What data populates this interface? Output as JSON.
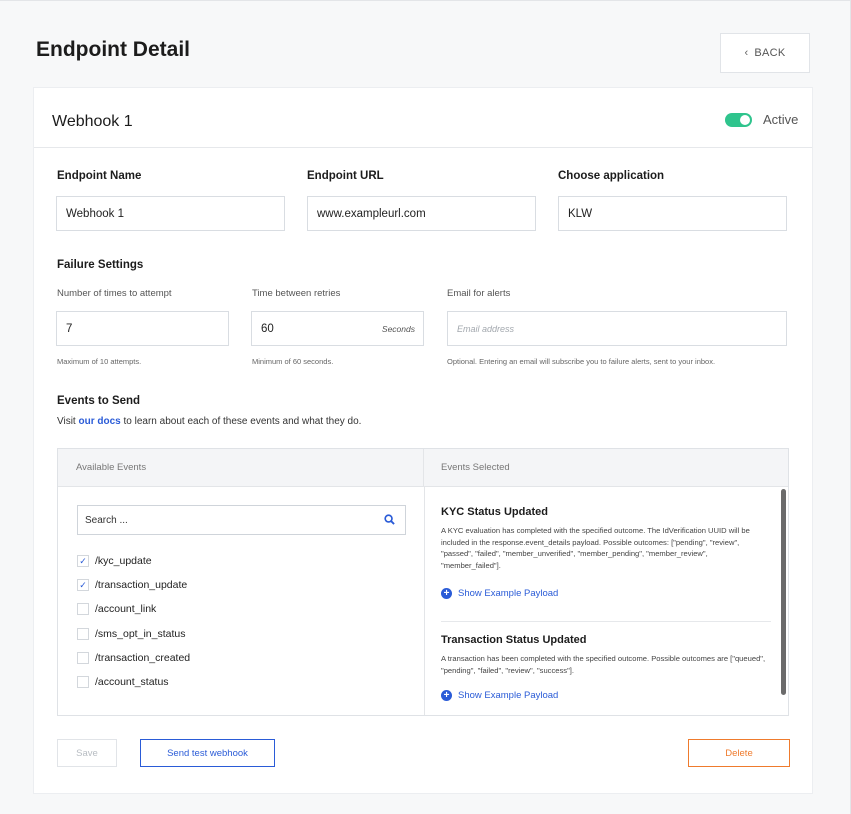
{
  "page": {
    "title": "Endpoint Detail",
    "back_label": "BACK"
  },
  "card": {
    "title": "Webhook 1",
    "status_label": "Active",
    "status_on": true,
    "toggle_color": "#2fc48d"
  },
  "fields": {
    "endpoint_name": {
      "label": "Endpoint Name",
      "value": "Webhook 1"
    },
    "endpoint_url": {
      "label": "Endpoint URL",
      "value": "www.exampleurl.com"
    },
    "application": {
      "label": "Choose application",
      "value": "KLW"
    }
  },
  "failure": {
    "heading": "Failure Settings",
    "attempts": {
      "label": "Number of times to attempt",
      "value": "7",
      "hint": "Maximum of 10 attempts."
    },
    "retries": {
      "label": "Time between retries",
      "value": "60",
      "unit": "Seconds",
      "hint": "Minimum of 60 seconds."
    },
    "email": {
      "label": "Email for alerts",
      "placeholder": "Email address",
      "hint": "Optional. Entering an email will subscribe you to failure alerts, sent to your inbox."
    }
  },
  "events": {
    "heading": "Events to Send",
    "visit_prefix": "Visit",
    "docs_link": "our docs",
    "visit_suffix": "to learn about each of these events and what they do.",
    "available_header": "Available Events",
    "selected_header": "Events Selected",
    "search_placeholder": "Search ...",
    "list": [
      {
        "name": "/kyc_update",
        "checked": true
      },
      {
        "name": "/transaction_update",
        "checked": true
      },
      {
        "name": "/account_link",
        "checked": false
      },
      {
        "name": "/sms_opt_in_status",
        "checked": false
      },
      {
        "name": "/transaction_created",
        "checked": false
      },
      {
        "name": "/account_status",
        "checked": false
      }
    ],
    "selected": [
      {
        "title": "KYC Status Updated",
        "description": "A KYC evaluation has completed with the specified outcome. The IdVerification UUID will be included in the response.event_details payload. Possible outcomes: [\"pending\", \"review\", \"passed\", \"failed\", \"member_unverified\", \"member_pending\", \"member_review\", \"member_failed\"].",
        "payload_label": "Show Example Payload"
      },
      {
        "title": "Transaction Status Updated",
        "description": "A transaction has been completed with the specified outcome. Possible outcomes are [\"queued\", \"pending\", \"failed\", \"review\", \"success\"].",
        "payload_label": "Show Example Payload"
      }
    ]
  },
  "actions": {
    "save_label": "Save",
    "test_label": "Send test webhook",
    "delete_label": "Delete"
  },
  "colors": {
    "link_blue": "#2a5bd7",
    "delete_orange": "#ef7b2d"
  },
  "icons": {
    "back": "chevron-left-icon",
    "search": "search-icon",
    "check": "check-icon",
    "expand": "plus-circle-icon"
  }
}
